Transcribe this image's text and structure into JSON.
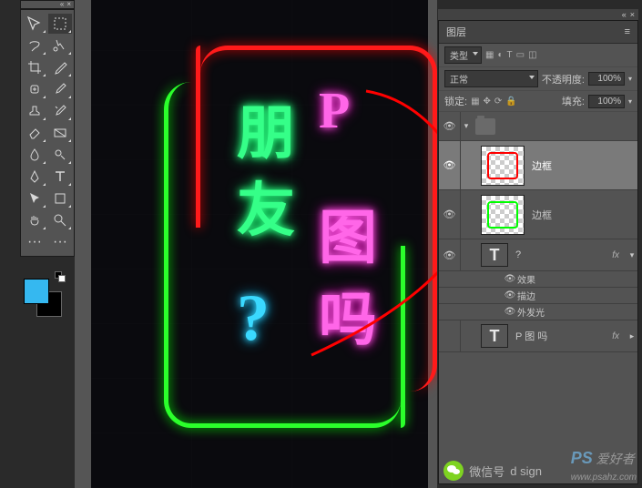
{
  "app_bar": {
    "collapse": "«",
    "close": "×"
  },
  "panel_tabs": {
    "collapse": "«",
    "close": "×"
  },
  "neon": {
    "t1": "朋",
    "t2": "P",
    "t3": "友",
    "t4": "图",
    "t5": "?",
    "t6": "吗"
  },
  "panel": {
    "title": "图层",
    "menu": "≡",
    "kind_label": "类型",
    "blend_mode": "正常",
    "opacity_label": "不透明度:",
    "opacity_value": "100%",
    "lock_label": "锁定:",
    "fill_label": "填充:",
    "fill_value": "100%"
  },
  "layers": {
    "frame1": "边框",
    "frame2": "边框",
    "q": "?",
    "fx": "fx",
    "effects": "效果",
    "stroke": "描边",
    "outer_glow": "外发光",
    "ptu": "P 图 吗"
  },
  "wechat": {
    "label": "微信号",
    "id": "d sign"
  },
  "watermark": {
    "brand": "PS",
    "text": "爱好者",
    "url": "www.psahz.com"
  }
}
